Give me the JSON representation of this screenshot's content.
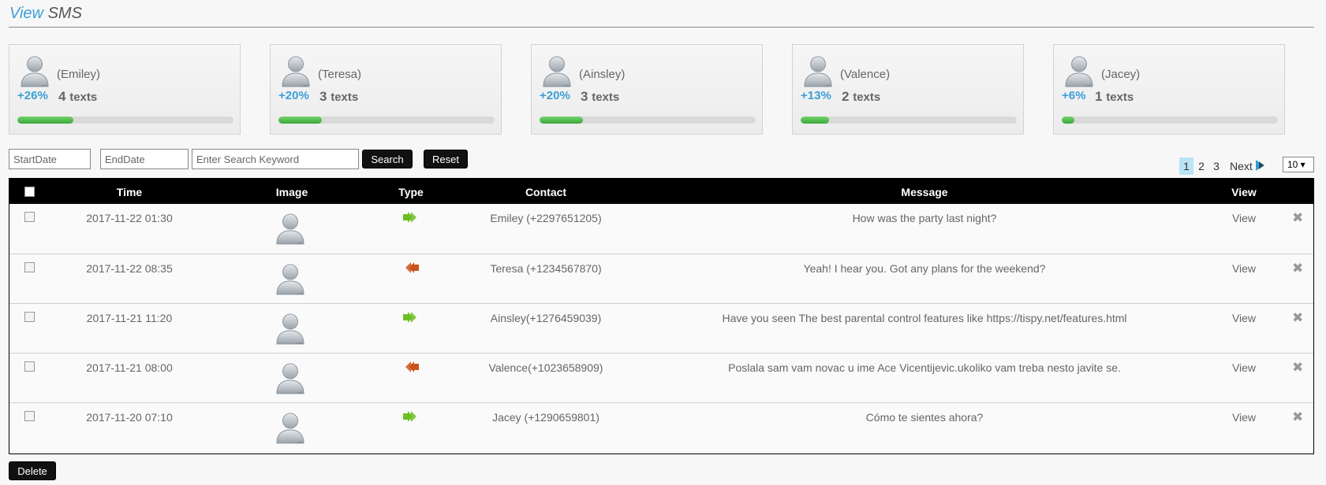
{
  "header": {
    "title_accent": "View",
    "title_rest": "SMS"
  },
  "stats": [
    {
      "name": "(Emiley)",
      "percent": "+26%",
      "count": "4",
      "unit": "texts",
      "progress": 0.26
    },
    {
      "name": "(Teresa)",
      "percent": "+20%",
      "count": "3",
      "unit": "texts",
      "progress": 0.2
    },
    {
      "name": "(Ainsley)",
      "percent": "+20%",
      "count": "3",
      "unit": "texts",
      "progress": 0.2
    },
    {
      "name": "(Valence)",
      "percent": "+13%",
      "count": "2",
      "unit": "texts",
      "progress": 0.13
    },
    {
      "name": "(Jacey)",
      "percent": "+6%",
      "count": "1",
      "unit": "texts",
      "progress": 0.06
    }
  ],
  "filters": {
    "start_placeholder": "StartDate",
    "end_placeholder": "EndDate",
    "keyword_placeholder": "Enter Search Keyword",
    "search_label": "Search",
    "reset_label": "Reset"
  },
  "pagination": {
    "pages": [
      "1",
      "2",
      "3"
    ],
    "current": "1",
    "next_label": "Next",
    "per_page": "10 ▾"
  },
  "table": {
    "columns": [
      "Time",
      "Image",
      "Type",
      "Contact",
      "Message",
      "View"
    ],
    "rows": [
      {
        "time": "2017-11-22 01:30",
        "type": "outgoing",
        "contact": "Emiley (+2297651205)",
        "message": "How was the party last night?",
        "view": "View"
      },
      {
        "time": "2017-11-22 08:35",
        "type": "incoming",
        "contact": "Teresa (+1234567870)",
        "message": "Yeah! I hear you. Got any plans for the weekend?",
        "view": "View"
      },
      {
        "time": "2017-11-21 11:20",
        "type": "outgoing",
        "contact": "Ainsley(+1276459039)",
        "message": "Have you seen The best parental control features like https://tispy.net/features.html",
        "view": "View"
      },
      {
        "time": "2017-11-21 08:00",
        "type": "incoming",
        "contact": "Valence(+1023658909)",
        "message": "Poslala sam vam novac u ime Ace Vicentijevic.ukoliko vam treba nesto javite se.",
        "view": "View"
      },
      {
        "time": "2017-11-20 07:10",
        "type": "outgoing",
        "contact": "Jacey (+1290659801)",
        "message": "Cómo te sientes ahora?",
        "view": "View"
      }
    ]
  },
  "footer": {
    "delete_label": "Delete"
  },
  "colors": {
    "accent": "#3b9fd8",
    "progress": "#3aa83b",
    "outgoing_arrow": "#6cc024",
    "incoming_arrow": "#c9541c",
    "header_bg": "#000000",
    "active_page": "#b9e4f7"
  },
  "icons": {
    "avatar": "user-avatar-icon",
    "outgoing": "outgoing-arrow-icon",
    "incoming": "incoming-arrow-icon",
    "delete": "close-icon",
    "next": "next-arrow-icon"
  }
}
